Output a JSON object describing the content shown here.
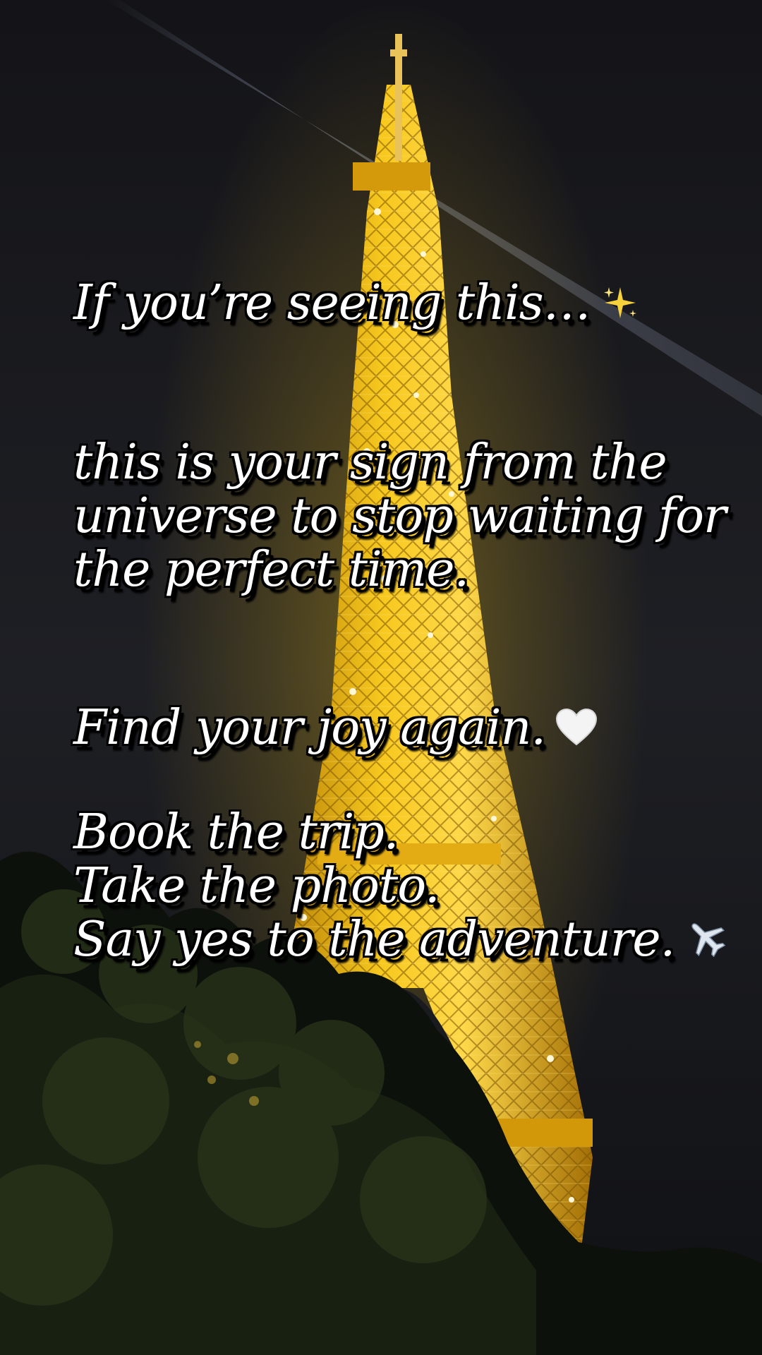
{
  "overlay": {
    "line1": "If you’re seeing this…",
    "line1_emoji": "sparkles-icon",
    "paragraph2": [
      "this is your sign from the",
      "universe to stop waiting for",
      "the perfect time."
    ],
    "line3": "Find your joy again.",
    "line3_emoji": "white-heart-icon",
    "paragraph4": [
      "Book the trip.",
      "Take the photo.",
      "Say yes to the adventure."
    ],
    "line4_emoji": "airplane-icon"
  },
  "colors": {
    "text": "#ffffff",
    "text_outline": "#000000",
    "tower_glow": "#f5c518",
    "sky": "#17181c"
  }
}
